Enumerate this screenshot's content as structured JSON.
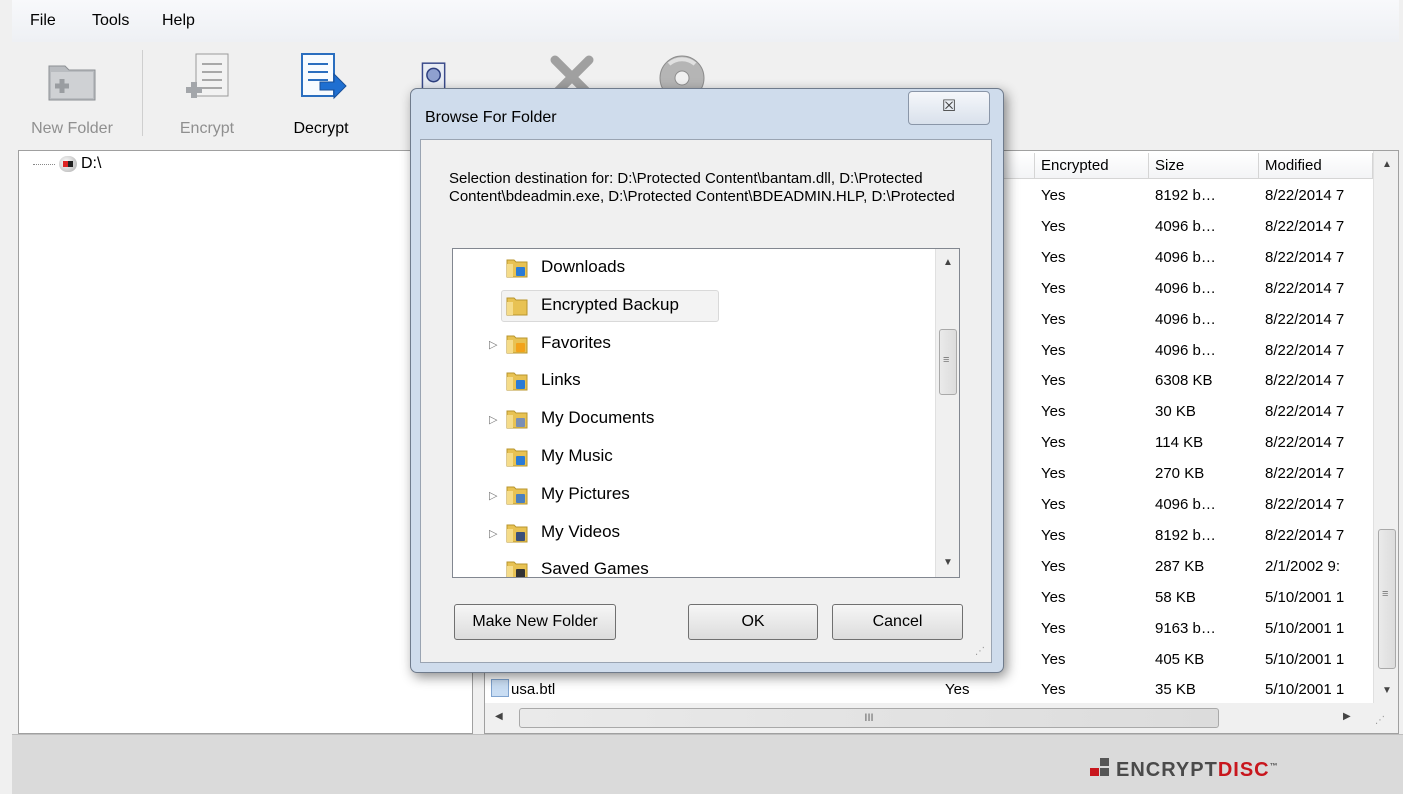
{
  "menu": [
    "File",
    "Tools",
    "Help"
  ],
  "toolbar": {
    "new_folder": "New Folder",
    "encrypt": "Encrypt",
    "decrypt": "Decrypt"
  },
  "tree": {
    "root": "D:\\"
  },
  "list": {
    "columns": [
      "d",
      "Encrypted",
      "Size",
      "Modified"
    ],
    "rows": [
      {
        "encrypted": "Yes",
        "size": "8192 b…",
        "modified": "8/22/2014 7"
      },
      {
        "encrypted": "Yes",
        "size": "4096 b…",
        "modified": "8/22/2014 7"
      },
      {
        "encrypted": "Yes",
        "size": "4096 b…",
        "modified": "8/22/2014 7"
      },
      {
        "encrypted": "Yes",
        "size": "4096 b…",
        "modified": "8/22/2014 7"
      },
      {
        "encrypted": "Yes",
        "size": "4096 b…",
        "modified": "8/22/2014 7"
      },
      {
        "encrypted": "Yes",
        "size": "4096 b…",
        "modified": "8/22/2014 7"
      },
      {
        "encrypted": "Yes",
        "size": "6308 KB",
        "modified": "8/22/2014 7"
      },
      {
        "encrypted": "Yes",
        "size": "30 KB",
        "modified": "8/22/2014 7"
      },
      {
        "encrypted": "Yes",
        "size": "114 KB",
        "modified": "8/22/2014 7"
      },
      {
        "encrypted": "Yes",
        "size": "270 KB",
        "modified": "8/22/2014 7"
      },
      {
        "encrypted": "Yes",
        "size": "4096 b…",
        "modified": "8/22/2014 7"
      },
      {
        "encrypted": "Yes",
        "size": "8192 b…",
        "modified": "8/22/2014 7"
      },
      {
        "encrypted": "Yes",
        "size": "287 KB",
        "modified": "2/1/2002 9:"
      },
      {
        "encrypted": "Yes",
        "size": "58 KB",
        "modified": "5/10/2001 1"
      },
      {
        "encrypted": "Yes",
        "size": "9163 b…",
        "modified": "5/10/2001 1"
      },
      {
        "encrypted": "Yes",
        "size": "405 KB",
        "modified": "5/10/2001 1"
      },
      {
        "name": "usa.btl",
        "protected": "Yes",
        "encrypted": "Yes",
        "size": "35 KB",
        "modified": "5/10/2001 1"
      }
    ],
    "hscroll_grip": "III"
  },
  "dialog": {
    "title": "Browse For Folder",
    "close_glyph": "☒",
    "message": "Selection destination for: D:\\Protected Content\\bantam.dll, D:\\Protected Content\\bdeadmin.exe, D:\\Protected Content\\BDEADMIN.HLP, D:\\Protected",
    "folders": [
      {
        "label": "Downloads",
        "expandable": false,
        "selected": false
      },
      {
        "label": "Encrypted Backup",
        "expandable": false,
        "selected": true
      },
      {
        "label": "Favorites",
        "expandable": true,
        "selected": false
      },
      {
        "label": "Links",
        "expandable": false,
        "selected": false
      },
      {
        "label": "My Documents",
        "expandable": true,
        "selected": false
      },
      {
        "label": "My Music",
        "expandable": false,
        "selected": false
      },
      {
        "label": "My Pictures",
        "expandable": true,
        "selected": false
      },
      {
        "label": "My Videos",
        "expandable": true,
        "selected": false
      },
      {
        "label": "Saved Games",
        "expandable": false,
        "selected": false
      }
    ],
    "make_new_folder": "Make New Folder",
    "ok": "OK",
    "cancel": "Cancel"
  },
  "brand": {
    "prefix": "ENCRYPT",
    "suffix": "DISC",
    "tm": "™"
  },
  "colors": {
    "dialog_frame": "#cfdcec",
    "brand_red": "#c8161d",
    "decrypt_blue": "#1f6fd1"
  }
}
